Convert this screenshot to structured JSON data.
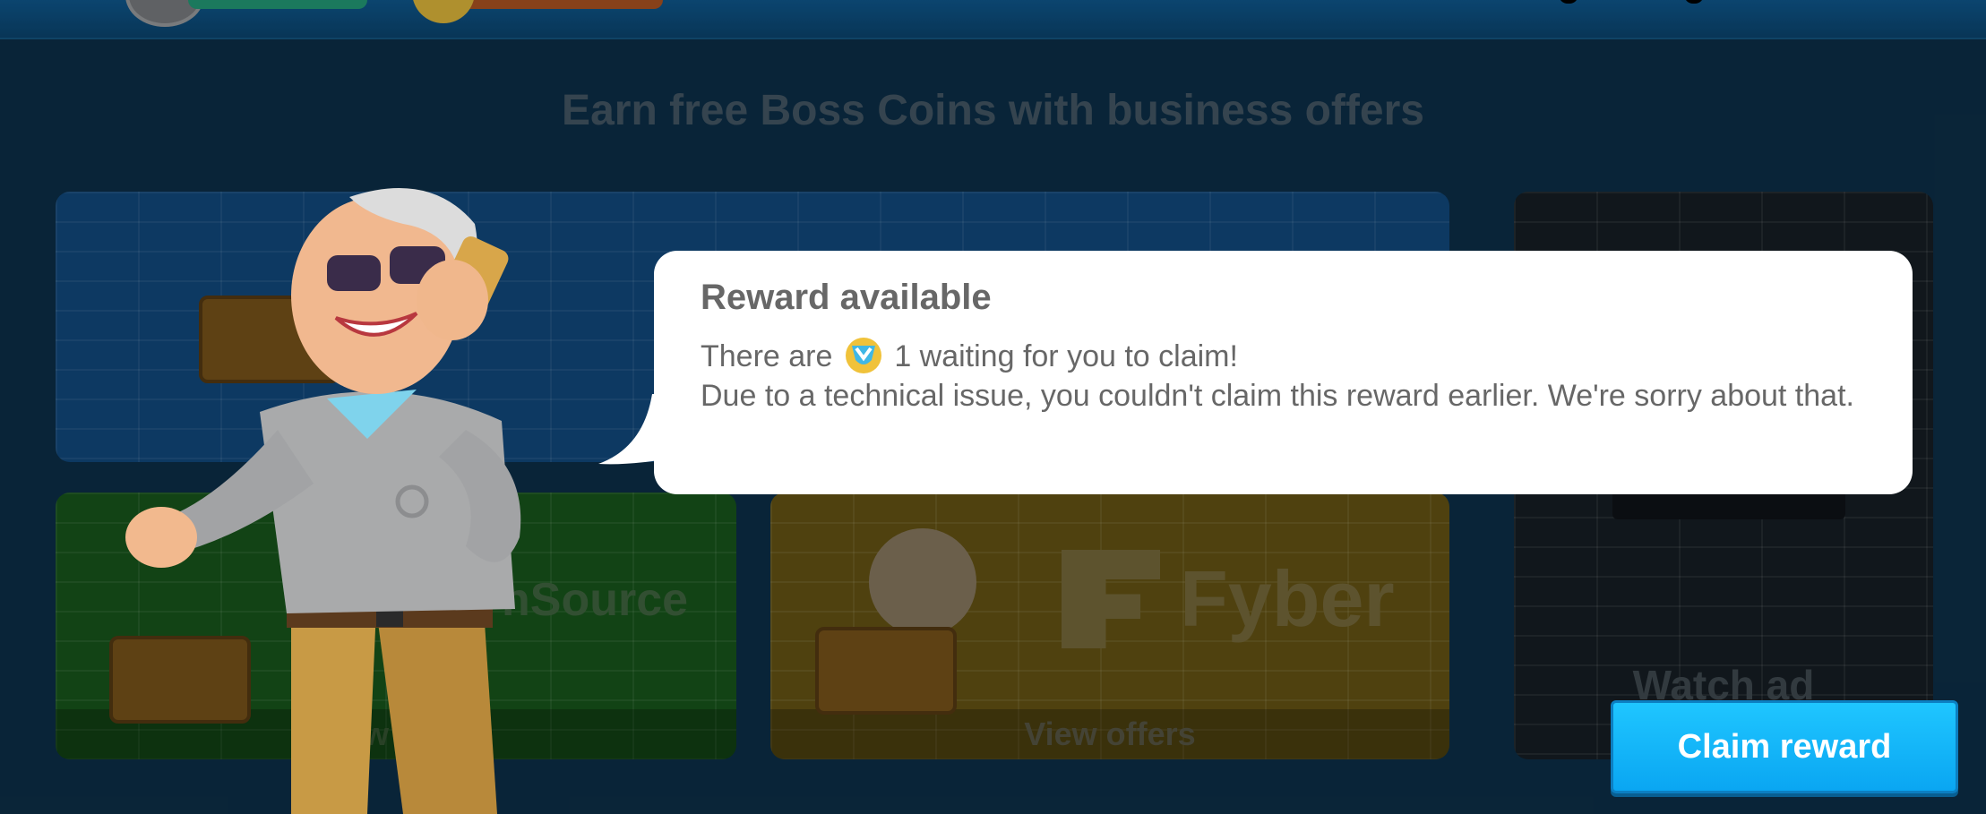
{
  "page": {
    "heading": "Earn free Boss Coins with business offers"
  },
  "offers": {
    "ironsource_brand": "nSource",
    "ironsource_button": "w of",
    "fyber_brand": "Fyber",
    "fyber_button": "View offers",
    "watch_ad": "Watch ad"
  },
  "dialog": {
    "title": "Reward available",
    "line1_prefix": "There are",
    "line1_icon": "boss-coin-icon",
    "line1_suffix": "1 waiting for you to claim!",
    "line2": "Due to a technical issue, you couldn't claim this reward earlier. We're sorry about that."
  },
  "actions": {
    "claim_label": "Claim reward"
  },
  "colors": {
    "accent": "#0aa6f2",
    "dialog_text": "#676767",
    "bubble": "#ffffff"
  }
}
